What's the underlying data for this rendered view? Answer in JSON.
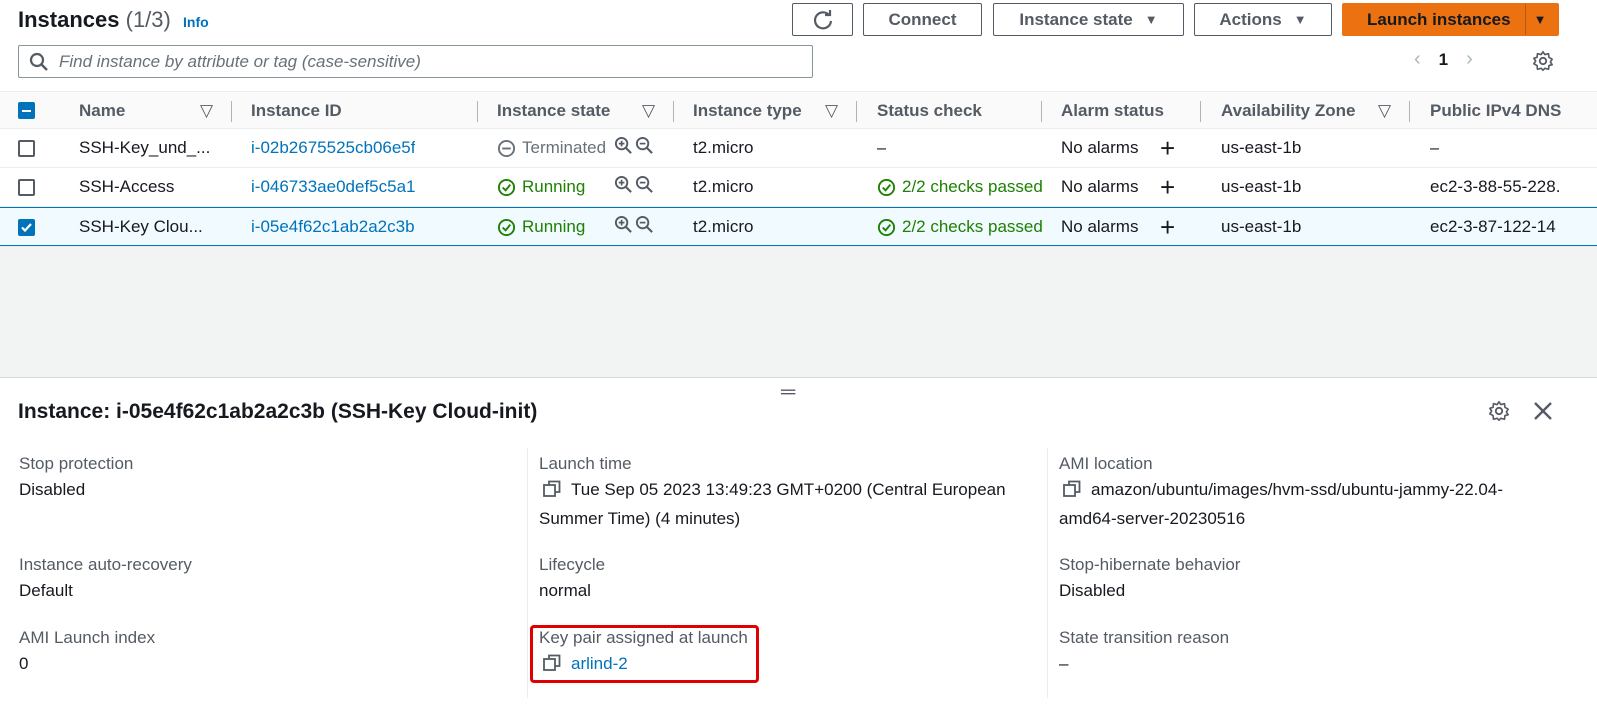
{
  "header": {
    "title": "Instances",
    "count": "(1/3)",
    "info": "Info",
    "connect_label": "Connect",
    "instance_state_label": "Instance state",
    "actions_label": "Actions",
    "launch_label": "Launch instances"
  },
  "search": {
    "placeholder": "Find instance by attribute or tag (case-sensitive)"
  },
  "pagination": {
    "page": "1"
  },
  "table": {
    "columns": [
      "Name",
      "Instance ID",
      "Instance state",
      "Instance type",
      "Status check",
      "Alarm status",
      "Availability Zone",
      "Public IPv4 DNS"
    ],
    "rows": [
      {
        "name": "SSH-Key_und_...",
        "id": "i-02b2675525cb06e5f",
        "state": "Terminated",
        "type": "t2.micro",
        "status": "–",
        "alarm": "No alarms",
        "az": "us-east-1b",
        "dns": "–",
        "selected": false
      },
      {
        "name": "SSH-Access",
        "id": "i-046733ae0def5c5a1",
        "state": "Running",
        "type": "t2.micro",
        "status": "2/2 checks passed",
        "alarm": "No alarms",
        "az": "us-east-1b",
        "dns": "ec2-3-88-55-228.",
        "selected": false
      },
      {
        "name": "SSH-Key Clou...",
        "id": "i-05e4f62c1ab2a2c3b",
        "state": "Running",
        "type": "t2.micro",
        "status": "2/2 checks passed",
        "alarm": "No alarms",
        "az": "us-east-1b",
        "dns": "ec2-3-87-122-14",
        "selected": true
      }
    ]
  },
  "details": {
    "title": "Instance: i-05e4f62c1ab2a2c3b (SSH-Key Cloud-init)",
    "stop_protection": {
      "label": "Stop protection",
      "value": "Disabled"
    },
    "auto_recovery": {
      "label": "Instance auto-recovery",
      "value": "Default"
    },
    "ami_launch_index": {
      "label": "AMI Launch index",
      "value": "0"
    },
    "launch_time": {
      "label": "Launch time",
      "value_line1": "Tue Sep 05 2023 13:49:23 GMT+0200 (Central European",
      "value_line2": "Summer Time) (4 minutes)"
    },
    "lifecycle": {
      "label": "Lifecycle",
      "value": "normal"
    },
    "key_pair": {
      "label": "Key pair assigned at launch",
      "value": "arlind-2"
    },
    "ami_location": {
      "label": "AMI location",
      "value_line1": "amazon/ubuntu/images/hvm-ssd/ubuntu-jammy-22.04-",
      "value_line2": "amd64-server-20230516"
    },
    "hibernate": {
      "label": "Stop-hibernate behavior",
      "value": "Disabled"
    },
    "state_reason": {
      "label": "State transition reason",
      "value": "–"
    }
  },
  "colors": {
    "accent": "#ec7211",
    "link": "#0073bb",
    "success": "#1d8102",
    "highlight": "#e00000"
  }
}
